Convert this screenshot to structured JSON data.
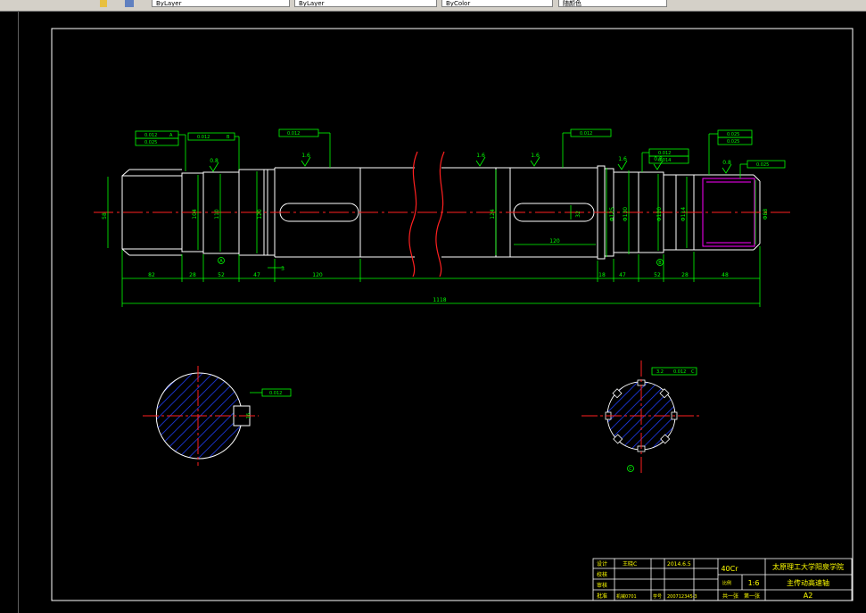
{
  "toolbar": {
    "combo1": "ByLayer",
    "combo2": "ByLayer",
    "combo3": "ByColor",
    "combo4": "随颜色"
  },
  "dims": {
    "d58": "58",
    "d104": "104",
    "d110": "110",
    "d120": "120",
    "d124": "124",
    "d32": "32",
    "d125": "Φ125",
    "d130": "Φ130",
    "d120b": "Φ120",
    "d114": "Φ114",
    "d88": "Φ88",
    "l82": "82",
    "l28a": "28",
    "l52a": "52",
    "l47a": "47",
    "l120a": "120",
    "l3": "3",
    "l18": "18",
    "l47b": "47",
    "l52b": "52",
    "l28b": "28",
    "l48": "48",
    "l120b": "120",
    "total": "1118",
    "sec_width": "16",
    "spline_w": "3.2"
  },
  "roughness": {
    "r1": "0.8",
    "r2": "1.6",
    "r3": "1.6",
    "r4": "1.6",
    "r5": "1.6",
    "r6": "0.8",
    "r7": "0.8"
  },
  "tolerances": {
    "t1a": "0.012",
    "t1b": "0.025",
    "t2": "0.012",
    "t3": "0.012",
    "t4": "0.012",
    "t5": "0.012",
    "t6a": "0.025",
    "t6b": "0.025",
    "t7": "0.012",
    "t8": "0.014",
    "t9": "0.025",
    "datum_a": "A",
    "datum_b": "B",
    "datum_c": "C",
    "key_tol": "0.012"
  },
  "datum_labels": {
    "a": "A",
    "b": "B",
    "c": "C"
  },
  "title_block": {
    "design": "设计",
    "check": "校核",
    "review": "审核",
    "approve": "批准",
    "designer": "王晓C",
    "date": "2014.6.5",
    "material": "40Cr",
    "scale_label": "比例",
    "scale": "1:6",
    "school": "太原理工大学阳泉学院",
    "part_name": "主传动高速轴",
    "sheets": "共一张",
    "sheet_no": "第一张",
    "sheet_size": "A2",
    "student_no": "200712345-3",
    "class_label": "学号",
    "class_no": "机械0701"
  }
}
